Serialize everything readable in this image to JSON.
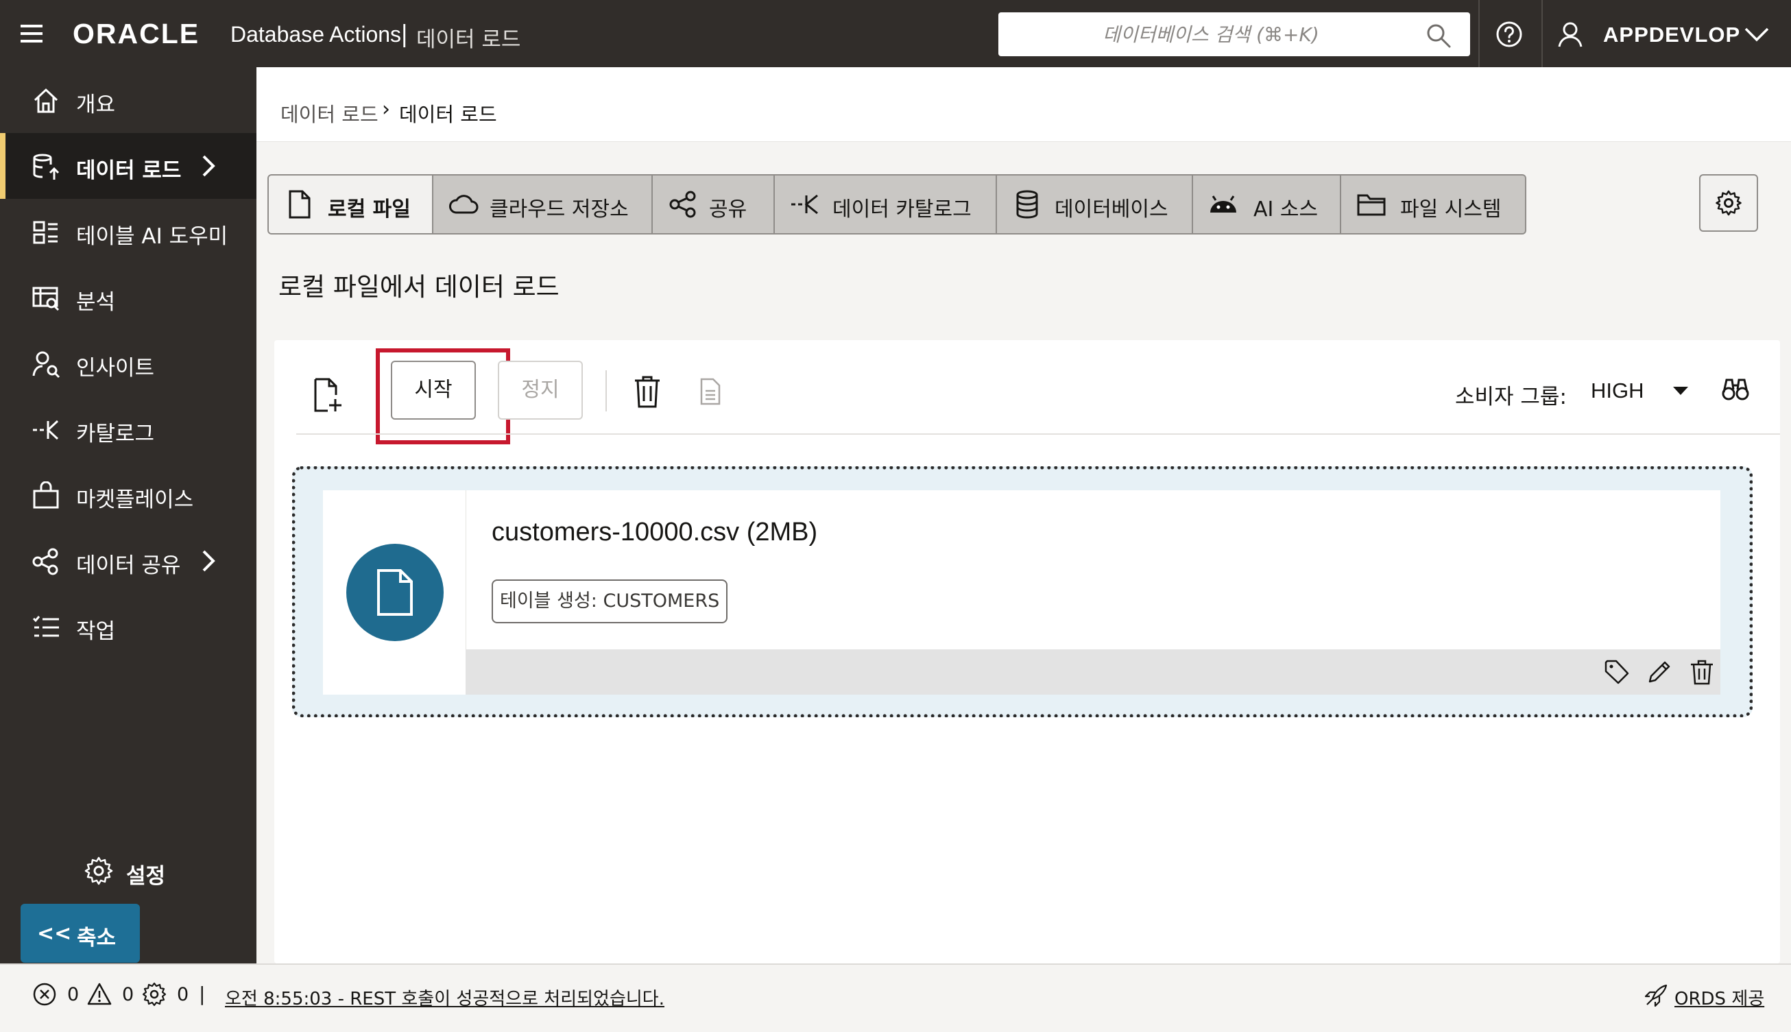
{
  "header": {
    "brand": "ORACLE",
    "product": "Database Actions",
    "separator": "|",
    "page_name": "데이터 로드",
    "search_placeholder": "데이터베이스 검색 (⌘+K)",
    "user_name": "APPDEVLOP"
  },
  "sidebar": {
    "items": [
      {
        "label": "개요",
        "icon": "home-icon"
      },
      {
        "label": "데이터 로드",
        "icon": "data-load-icon",
        "active": true,
        "has_submenu": true
      },
      {
        "label": "테이블 AI 도우미",
        "icon": "table-ai-icon"
      },
      {
        "label": "분석",
        "icon": "analysis-icon"
      },
      {
        "label": "인사이트",
        "icon": "insights-icon"
      },
      {
        "label": "카탈로그",
        "icon": "catalog-icon"
      },
      {
        "label": "마켓플레이스",
        "icon": "marketplace-icon"
      },
      {
        "label": "데이터 공유",
        "icon": "share-icon",
        "has_submenu": true
      },
      {
        "label": "작업",
        "icon": "jobs-icon"
      }
    ],
    "settings_label": "설정",
    "collapse_icon": "<<",
    "collapse_label": "축소"
  },
  "breadcrumb": {
    "parent": "데이터 로드",
    "separator": "›",
    "current": "데이터 로드"
  },
  "tabs": [
    {
      "label": "로컬 파일",
      "icon": "file-icon",
      "active": true
    },
    {
      "label": "클라우드 저장소",
      "icon": "cloud-icon"
    },
    {
      "label": "공유",
      "icon": "share-icon"
    },
    {
      "label": "데이터 카탈로그",
      "icon": "catalog-icon"
    },
    {
      "label": "데이터베이스",
      "icon": "database-icon"
    },
    {
      "label": "AI 소스",
      "icon": "ai-source-icon"
    },
    {
      "label": "파일 시스템",
      "icon": "folder-icon"
    }
  ],
  "section_title": "로컬 파일에서 데이터 로드",
  "toolbar": {
    "start_label": "시작",
    "stop_label": "정지",
    "consumer_group_label": "소비자 그룹:",
    "consumer_group_value": "HIGH"
  },
  "load_item": {
    "file_name": "customers-10000.csv (2MB)",
    "target_label": "테이블 생성: CUSTOMERS"
  },
  "status_bar": {
    "errors": "0",
    "warnings": "0",
    "jobs": "0",
    "separator": "|",
    "message": "오전 8:55:03 - REST 호출이 성공적으로 처리되었습니다.",
    "ords_label": "ORDS 제공"
  },
  "colors": {
    "header_bg": "#312d2a",
    "sidebar_active_accent": "#f0cc71",
    "collapse_button": "#1e6f96",
    "file_badge": "#1f6b8f",
    "highlight": "#c7182e",
    "dropzone_bg": "#e7f1f6"
  }
}
